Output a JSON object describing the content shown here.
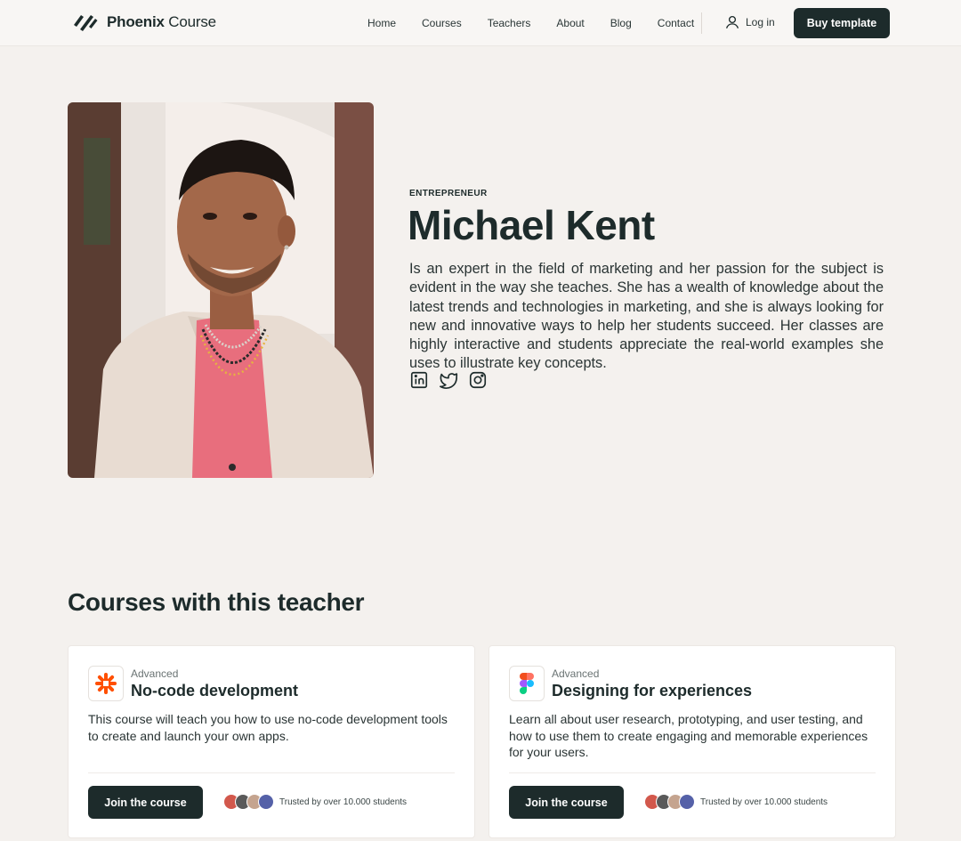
{
  "header": {
    "brand_bold": "Phoenix",
    "brand_light": "Course",
    "nav": [
      "Home",
      "Courses",
      "Teachers",
      "About",
      "Blog",
      "Contact"
    ],
    "login_label": "Log in",
    "buy_label": "Buy template"
  },
  "teacher": {
    "role": "ENTREPRENEUR",
    "name": "Michael Kent",
    "bio": "Is an expert in the field of marketing and her passion for the subject is evident in the way she teaches. She has a wealth of knowledge about the latest trends and technologies in marketing, and she is always looking for new and innovative ways to help her students succeed. Her classes are highly interactive and students appreciate the real-world examples she uses to illustrate key concepts.",
    "socials": [
      "linkedin-icon",
      "twitter-icon",
      "instagram-icon"
    ]
  },
  "courses_section": {
    "title": "Courses with this teacher",
    "cards": [
      {
        "icon": "zapier-icon",
        "level": "Advanced",
        "title": "No-code development",
        "description": "This course will teach you how to use no-code development tools to create and launch your own apps.",
        "button": "Join the course",
        "trusted": "Trusted by over 10.000 students"
      },
      {
        "icon": "figma-icon",
        "level": "Advanced",
        "title": "Designing for experiences",
        "description": "Learn all about user research, prototyping, and user testing, and how to use them to create engaging and memorable experiences for your users.",
        "button": "Join the course",
        "trusted": "Trusted by over 10.000 students"
      }
    ]
  },
  "colors": {
    "background": "#f4f1ee",
    "primary_dark": "#1d2b2b",
    "card": "#ffffff",
    "zapier_orange": "#ff4f00"
  }
}
